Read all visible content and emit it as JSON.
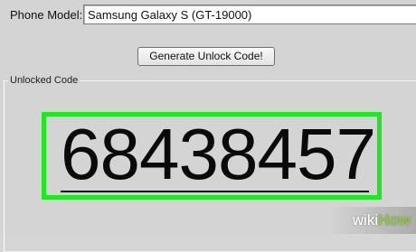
{
  "form": {
    "phone_model_label": "Phone Model:",
    "phone_model_value": "Samsung Galaxy S (GT-19000)",
    "generate_button_label": "Generate Unlock Code!"
  },
  "result": {
    "group_title": "Unlocked Code",
    "code": "68438457"
  },
  "watermark": {
    "wiki": "wiki",
    "how": "How"
  },
  "colors": {
    "highlight_border": "#1ee81e",
    "background": "#d4d4d4",
    "watermark_green": "#8dc63f"
  }
}
